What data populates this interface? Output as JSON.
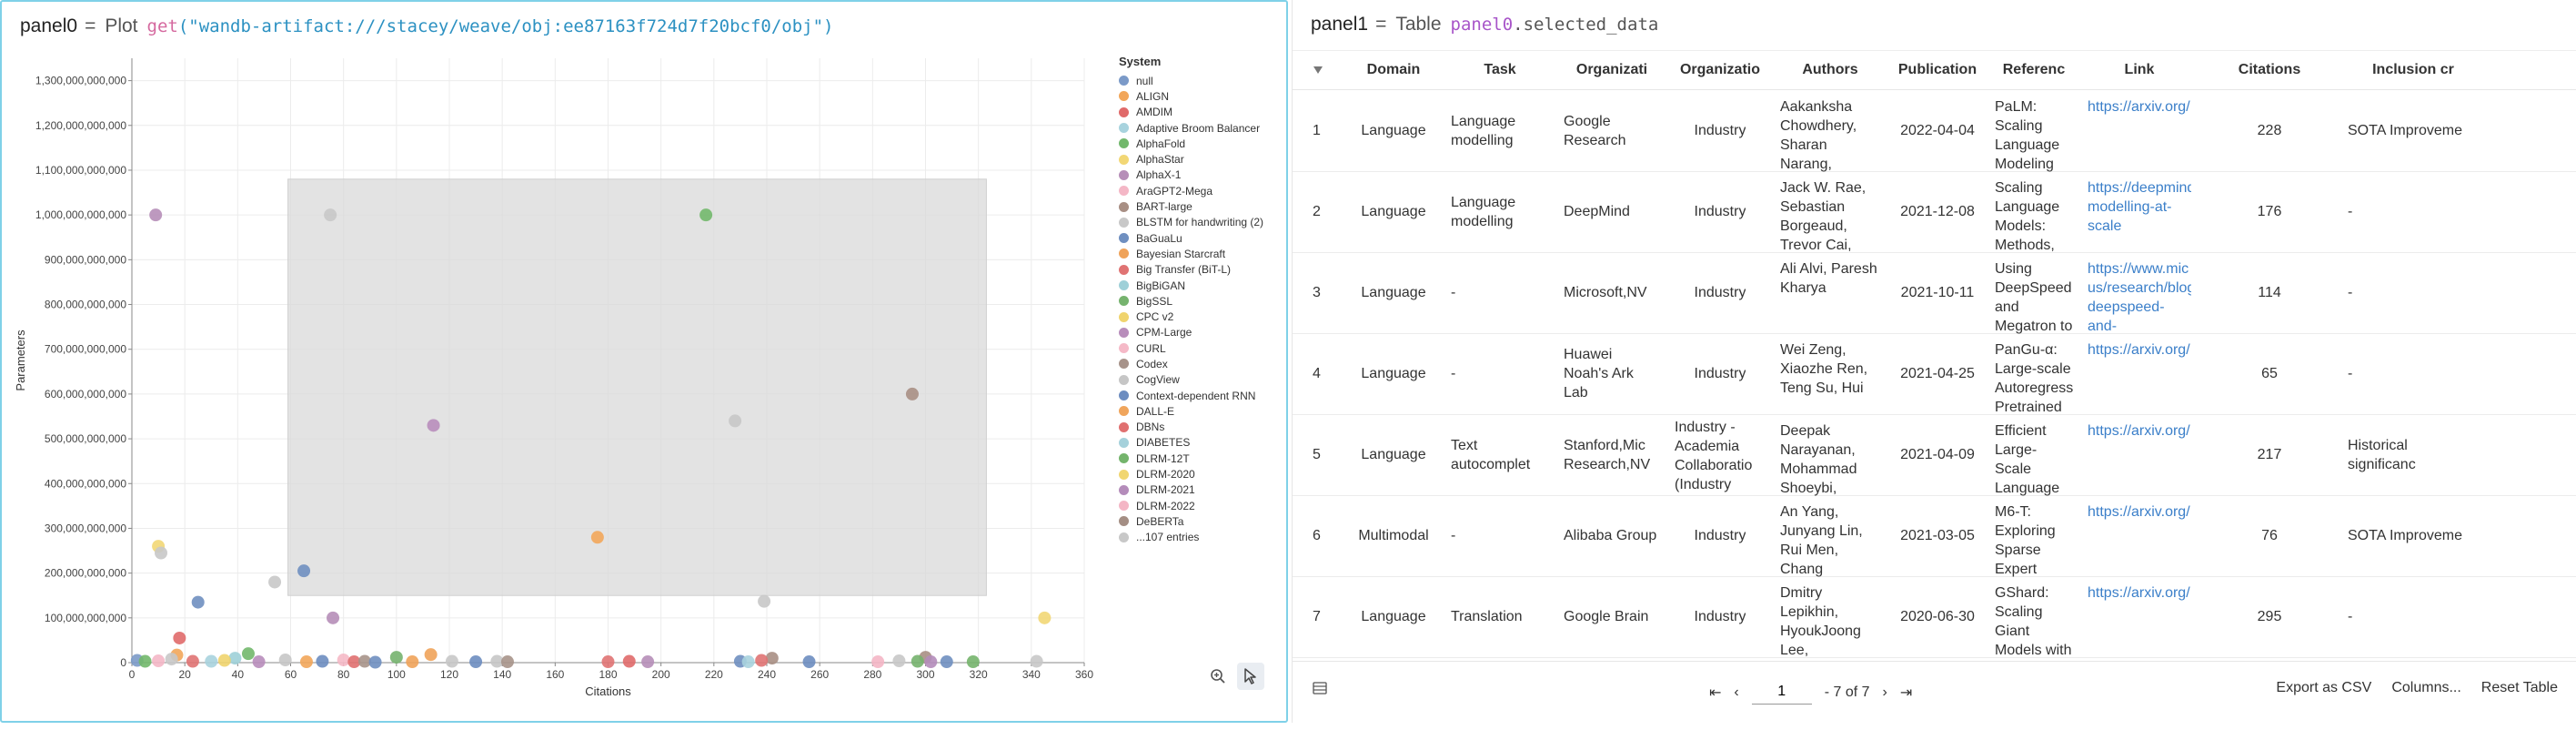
{
  "panel0": {
    "name": "panel0",
    "eq": "=",
    "kind": "Plot",
    "fn": "get",
    "arg": "(\"wandb-artifact:///stacey/weave/obj:ee87163f724d7f20bcf0/obj\")"
  },
  "panel1": {
    "name": "panel1",
    "eq": "=",
    "kind": "Table",
    "ref_var": "panel0",
    "ref_prop": ".selected_data"
  },
  "chart_data": {
    "type": "scatter",
    "xlabel": "Citations",
    "ylabel": "Parameters",
    "xlim": [
      0,
      360
    ],
    "ylim": [
      0,
      1350000000000
    ],
    "x_ticks": [
      0,
      20,
      40,
      60,
      80,
      100,
      120,
      140,
      160,
      180,
      200,
      220,
      240,
      260,
      280,
      300,
      320,
      340,
      360
    ],
    "y_ticks": [
      0,
      100000000000,
      200000000000,
      300000000000,
      400000000000,
      500000000000,
      600000000000,
      700000000000,
      800000000000,
      900000000000,
      1000000000000,
      1100000000000,
      1200000000000,
      1300000000000
    ],
    "y_tick_labels": [
      "0",
      "100,000,000,000",
      "200,000,000,000",
      "300,000,000,000",
      "400,000,000,000",
      "500,000,000,000",
      "600,000,000,000",
      "700,000,000,000",
      "800,000,000,000",
      "900,000,000,000",
      "1,000,000,000,000",
      "1,100,000,000,000",
      "1,200,000,000,000",
      "1,300,000,000,000"
    ],
    "selection": {
      "x": [
        59,
        323
      ],
      "y": [
        150000000000,
        1080000000000
      ]
    },
    "legend_title": "System",
    "legend": [
      {
        "name": "null",
        "color": "#7b9ac8"
      },
      {
        "name": "ALIGN",
        "color": "#f2a65a"
      },
      {
        "name": "AMDIM",
        "color": "#e06a6a"
      },
      {
        "name": "Adaptive Broom Balancer",
        "color": "#a8d3de"
      },
      {
        "name": "AlphaFold",
        "color": "#72b86c"
      },
      {
        "name": "AlphaStar",
        "color": "#f2d775"
      },
      {
        "name": "AlphaX-1",
        "color": "#b68eb8"
      },
      {
        "name": "AraGPT2-Mega",
        "color": "#f4b7c6"
      },
      {
        "name": "BART-large",
        "color": "#a88f84"
      },
      {
        "name": "BLSTM for handwriting (2)",
        "color": "#c8c8c8"
      },
      {
        "name": "BaGuaLu",
        "color": "#6f8fc0"
      },
      {
        "name": "Bayesian Starcraft",
        "color": "#efa35a"
      },
      {
        "name": "Big Transfer (BiT-L)",
        "color": "#e07373"
      },
      {
        "name": "BigBiGAN",
        "color": "#9fd0d8"
      },
      {
        "name": "BigSSL",
        "color": "#76b36e"
      },
      {
        "name": "CPC v2",
        "color": "#f0d46e"
      },
      {
        "name": "CPM-Large",
        "color": "#b88dbb"
      },
      {
        "name": "CURL",
        "color": "#f5b9c7"
      },
      {
        "name": "Codex",
        "color": "#a7938a"
      },
      {
        "name": "CogView",
        "color": "#c6c6c6"
      },
      {
        "name": "Context-dependent RNN",
        "color": "#6d8dc0"
      },
      {
        "name": "DALL-E",
        "color": "#f0a55c"
      },
      {
        "name": "DBNs",
        "color": "#e07070"
      },
      {
        "name": "DIABETES",
        "color": "#a5d1db"
      },
      {
        "name": "DLRM-12T",
        "color": "#74b46c"
      },
      {
        "name": "DLRM-2020",
        "color": "#f1d671"
      },
      {
        "name": "DLRM-2021",
        "color": "#b48cba"
      },
      {
        "name": "DLRM-2022",
        "color": "#f4b6c5"
      },
      {
        "name": "DeBERTa",
        "color": "#a48e84"
      },
      {
        "name": "...107 entries",
        "color": "#c8c8c8"
      }
    ],
    "points": [
      {
        "x": 9,
        "y": 1000000000000,
        "color": "#b68eb8"
      },
      {
        "x": 75,
        "y": 1000000000000,
        "color": "#c8c8c8"
      },
      {
        "x": 217,
        "y": 1000000000000,
        "color": "#72b86c"
      },
      {
        "x": 295,
        "y": 600000000000,
        "color": "#a88f84"
      },
      {
        "x": 228,
        "y": 540000000000,
        "color": "#c6c6c6"
      },
      {
        "x": 114,
        "y": 530000000000,
        "color": "#b88dbb"
      },
      {
        "x": 176,
        "y": 280000000000,
        "color": "#f2a65a"
      },
      {
        "x": 10,
        "y": 260000000000,
        "color": "#f2d775"
      },
      {
        "x": 11,
        "y": 245000000000,
        "color": "#c8c8c8"
      },
      {
        "x": 65,
        "y": 205000000000,
        "color": "#6f8fc0"
      },
      {
        "x": 54,
        "y": 180000000000,
        "color": "#c8c8c8"
      },
      {
        "x": 239,
        "y": 137000000000,
        "color": "#c8c8c8"
      },
      {
        "x": 25,
        "y": 135000000000,
        "color": "#6f8fc0"
      },
      {
        "x": 345,
        "y": 100000000000,
        "color": "#f2d775"
      },
      {
        "x": 76,
        "y": 100000000000,
        "color": "#b68eb8"
      },
      {
        "x": 18,
        "y": 55000000000,
        "color": "#e06a6a"
      },
      {
        "x": 44,
        "y": 20000000000,
        "color": "#72b86c"
      },
      {
        "x": 113,
        "y": 18000000000,
        "color": "#efa35a"
      },
      {
        "x": 17,
        "y": 17000000000,
        "color": "#f2a65a"
      },
      {
        "x": 100,
        "y": 12000000000,
        "color": "#76b36e"
      },
      {
        "x": 39,
        "y": 10000000000,
        "color": "#9fd0d8"
      },
      {
        "x": 242,
        "y": 10000000000,
        "color": "#a88f84"
      },
      {
        "x": 300,
        "y": 12000000000,
        "color": "#a88f84"
      },
      {
        "x": 2,
        "y": 5000000000,
        "color": "#7b9ac8"
      },
      {
        "x": 5,
        "y": 3000000000,
        "color": "#72b86c"
      },
      {
        "x": 10,
        "y": 4000000000,
        "color": "#f4b7c6"
      },
      {
        "x": 15,
        "y": 8000000000,
        "color": "#c8c8c8"
      },
      {
        "x": 23,
        "y": 3000000000,
        "color": "#e07373"
      },
      {
        "x": 30,
        "y": 3000000000,
        "color": "#a8d3de"
      },
      {
        "x": 35,
        "y": 5000000000,
        "color": "#f0d46e"
      },
      {
        "x": 48,
        "y": 2000000000,
        "color": "#b88dbb"
      },
      {
        "x": 58,
        "y": 6000000000,
        "color": "#c6c6c6"
      },
      {
        "x": 66,
        "y": 2000000000,
        "color": "#f2a65a"
      },
      {
        "x": 72,
        "y": 3000000000,
        "color": "#6d8dc0"
      },
      {
        "x": 80,
        "y": 6000000000,
        "color": "#f5b9c7"
      },
      {
        "x": 84,
        "y": 2000000000,
        "color": "#e07070"
      },
      {
        "x": 88,
        "y": 3000000000,
        "color": "#a7938a"
      },
      {
        "x": 92,
        "y": 1000000000,
        "color": "#6f8fc0"
      },
      {
        "x": 106,
        "y": 2000000000,
        "color": "#efa35a"
      },
      {
        "x": 121,
        "y": 3000000000,
        "color": "#c8c8c8"
      },
      {
        "x": 130,
        "y": 2000000000,
        "color": "#6d8dc0"
      },
      {
        "x": 138,
        "y": 3000000000,
        "color": "#c6c6c6"
      },
      {
        "x": 142,
        "y": 2000000000,
        "color": "#a7938a"
      },
      {
        "x": 180,
        "y": 2000000000,
        "color": "#e07373"
      },
      {
        "x": 188,
        "y": 3000000000,
        "color": "#e06a6a"
      },
      {
        "x": 195,
        "y": 2000000000,
        "color": "#b68eb8"
      },
      {
        "x": 230,
        "y": 3000000000,
        "color": "#6f8fc0"
      },
      {
        "x": 233,
        "y": 2000000000,
        "color": "#a8d3de"
      },
      {
        "x": 238,
        "y": 5000000000,
        "color": "#e07373"
      },
      {
        "x": 256,
        "y": 2000000000,
        "color": "#6d8dc0"
      },
      {
        "x": 282,
        "y": 2000000000,
        "color": "#f4b6c5"
      },
      {
        "x": 290,
        "y": 4000000000,
        "color": "#c8c8c8"
      },
      {
        "x": 297,
        "y": 3000000000,
        "color": "#76b36e"
      },
      {
        "x": 302,
        "y": 2000000000,
        "color": "#b48cba"
      },
      {
        "x": 308,
        "y": 2000000000,
        "color": "#6f8fc0"
      },
      {
        "x": 318,
        "y": 2000000000,
        "color": "#74b46c"
      },
      {
        "x": 342,
        "y": 3000000000,
        "color": "#c8c8c8"
      }
    ]
  },
  "table": {
    "columns": [
      "Domain",
      "Task",
      "Organizati",
      "Organizatio",
      "Authors",
      "Publication",
      "Referenc",
      "Link",
      "Citations",
      "Inclusion cr"
    ],
    "rows": [
      {
        "idx": "1",
        "domain": "Language",
        "task": "Language modelling",
        "org": "Google Research",
        "cat": "Industry",
        "authors": "Aakanksha Chowdhery, Sharan Narang,",
        "pub": "2022-04-04",
        "ref": "PaLM: Scaling Language Modeling",
        "link": "https://arxiv.org/",
        "cit": "228",
        "inc": "SOTA Improveme"
      },
      {
        "idx": "2",
        "domain": "Language",
        "task": "Language modelling",
        "org": "DeepMind",
        "cat": "Industry",
        "authors": "Jack W. Rae, Sebastian Borgeaud, Trevor Cai,",
        "pub": "2021-12-08",
        "ref": "Scaling Language Models: Methods,",
        "link": "https://deepmind modelling-at- scale",
        "cit": "176",
        "inc": "-"
      },
      {
        "idx": "3",
        "domain": "Language",
        "task": "-",
        "org": "Microsoft,NV",
        "cat": "Industry",
        "authors": "Ali Alvi, Paresh Kharya",
        "pub": "2021-10-11",
        "ref": "Using DeepSpeed and Megatron to",
        "link": "https://www.mic us/research/blog deepspeed-and-",
        "cit": "114",
        "inc": "-"
      },
      {
        "idx": "4",
        "domain": "Language",
        "task": "-",
        "org": "Huawei Noah's Ark Lab",
        "cat": "Industry",
        "authors": "Wei Zeng, Xiaozhe Ren, Teng Su, Hui",
        "pub": "2021-04-25",
        "ref": "PanGu-α: Large-scale Autoregressi Pretrained",
        "link": "https://arxiv.org/",
        "cit": "65",
        "inc": "-"
      },
      {
        "idx": "5",
        "domain": "Language",
        "task": "Text autocomplet",
        "org": "Stanford,Mic Research,NV",
        "cat": "Industry - Academia Collaboratio (Industry",
        "authors": "Deepak Narayanan, Mohammad Shoeybi,",
        "pub": "2021-04-09",
        "ref": "Efficient Large-Scale Language Model",
        "link": "https://arxiv.org/",
        "cit": "217",
        "inc": "Historical significanc"
      },
      {
        "idx": "6",
        "domain": "Multimodal",
        "task": "-",
        "org": "Alibaba Group",
        "cat": "Industry",
        "authors": "An Yang, Junyang Lin, Rui Men, Chang",
        "pub": "2021-03-05",
        "ref": "M6-T: Exploring Sparse Expert",
        "link": "https://arxiv.org/",
        "cit": "76",
        "inc": "SOTA Improveme"
      },
      {
        "idx": "7",
        "domain": "Language",
        "task": "Translation",
        "org": "Google Brain",
        "cat": "Industry",
        "authors": "Dmitry Lepikhin, HyoukJoong Lee,",
        "pub": "2020-06-30",
        "ref": "GShard: Scaling Giant Models with",
        "link": "https://arxiv.org/",
        "cit": "295",
        "inc": "-"
      }
    ]
  },
  "pagination": {
    "first": "⇤",
    "prev": "‹",
    "page": "1",
    "of": "- 7 of 7",
    "next": "›",
    "last": "⇥"
  },
  "footer": {
    "export": "Export as CSV",
    "columns": "Columns...",
    "reset": "Reset Table"
  }
}
